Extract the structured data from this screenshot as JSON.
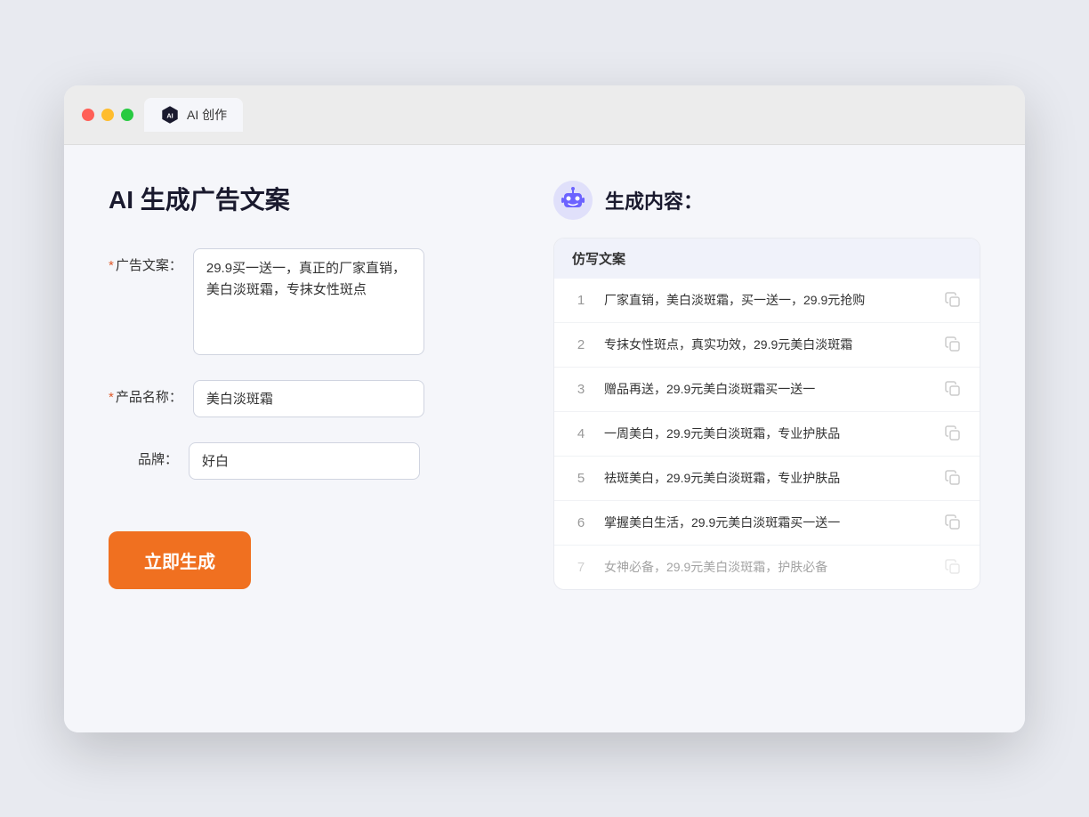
{
  "window": {
    "tab_label": "AI 创作"
  },
  "page": {
    "title": "AI 生成广告文案",
    "right_title": "生成内容："
  },
  "form": {
    "ad_copy_label": "广告文案：",
    "ad_copy_required": "*",
    "ad_copy_value": "29.9买一送一，真正的厂家直销，美白淡斑霜，专抹女性斑点",
    "product_name_label": "产品名称：",
    "product_name_required": "*",
    "product_name_value": "美白淡斑霜",
    "brand_label": "品牌：",
    "brand_value": "好白",
    "generate_btn": "立即生成"
  },
  "results": {
    "header": "仿写文案",
    "items": [
      {
        "num": "1",
        "text": "厂家直销，美白淡斑霜，买一送一，29.9元抢购",
        "faded": false
      },
      {
        "num": "2",
        "text": "专抹女性斑点，真实功效，29.9元美白淡斑霜",
        "faded": false
      },
      {
        "num": "3",
        "text": "赠品再送，29.9元美白淡斑霜买一送一",
        "faded": false
      },
      {
        "num": "4",
        "text": "一周美白，29.9元美白淡斑霜，专业护肤品",
        "faded": false
      },
      {
        "num": "5",
        "text": "祛斑美白，29.9元美白淡斑霜，专业护肤品",
        "faded": false
      },
      {
        "num": "6",
        "text": "掌握美白生活，29.9元美白淡斑霜买一送一",
        "faded": false
      },
      {
        "num": "7",
        "text": "女神必备，29.9元美白淡斑霜，护肤必备",
        "faded": true
      }
    ]
  }
}
